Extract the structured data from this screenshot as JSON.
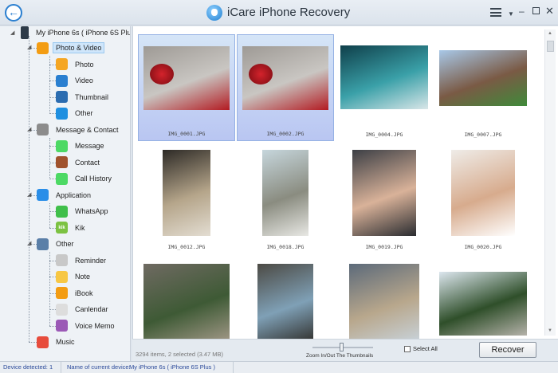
{
  "app": {
    "title": "iCare iPhone Recovery",
    "accent": "#2a7fd0"
  },
  "window": {
    "back_icon": "back-arrow-icon",
    "menu_icon": "hamburger-menu-icon",
    "dropdown_icon": "dropdown-arrow-icon",
    "minimize_glyph": "–",
    "close_glyph": "✕"
  },
  "sidebar": {
    "device": {
      "label": "My iPhone 6s ( iPhone 6S Plus )",
      "icon": "phone-icon"
    },
    "groups": [
      {
        "label": "Photo & Video",
        "icon": "photos-icon",
        "color": "#f39c12",
        "selected": true,
        "items": [
          {
            "label": "Photo",
            "icon": "photo-icon",
            "color": "#f5a623"
          },
          {
            "label": "Video",
            "icon": "video-camera-icon",
            "color": "#2a7fd0"
          },
          {
            "label": "Thumbnail",
            "icon": "thumbnail-icon",
            "color": "#2b6cb0"
          },
          {
            "label": "Other",
            "icon": "picture-icon",
            "color": "#1f8fe0"
          }
        ]
      },
      {
        "label": "Message & Contact",
        "icon": "contacts-icon",
        "color": "#8c8c8c",
        "items": [
          {
            "label": "Message",
            "icon": "message-icon",
            "color": "#4cd964"
          },
          {
            "label": "Contact",
            "icon": "contact-icon",
            "color": "#a0522d"
          },
          {
            "label": "Call History",
            "icon": "phone-call-icon",
            "color": "#4cd964"
          }
        ]
      },
      {
        "label": "Application",
        "icon": "app-store-icon",
        "color": "#2a8ee8",
        "items": [
          {
            "label": "WhatsApp",
            "icon": "whatsapp-icon",
            "color": "#3fbf4a"
          },
          {
            "label": "Kik",
            "icon": "kik-icon",
            "color": "#7cc242",
            "glyph": "kik"
          }
        ]
      },
      {
        "label": "Other",
        "icon": "list-icon",
        "color": "#5a7fa8",
        "items": [
          {
            "label": "Reminder",
            "icon": "reminder-icon",
            "color": "#c8c8c8"
          },
          {
            "label": "Note",
            "icon": "note-icon",
            "color": "#f7c744"
          },
          {
            "label": "iBook",
            "icon": "ibook-icon",
            "color": "#f39c12"
          },
          {
            "label": "Canlendar",
            "icon": "calendar-icon",
            "color": "#dddddd"
          },
          {
            "label": "Voice Memo",
            "icon": "microphone-icon",
            "color": "#9b59b6"
          }
        ]
      },
      {
        "label": "Music",
        "icon": "music-icon",
        "color": "#e74c3c",
        "items": []
      }
    ]
  },
  "thumbnails": [
    {
      "name": "IMG_0001.JPG",
      "selected": true,
      "colors": [
        "#9e9a95",
        "#c9c6c2",
        "#b31b22"
      ]
    },
    {
      "name": "IMG_0002.JPG",
      "selected": true,
      "colors": [
        "#9e9a95",
        "#c9c6c2",
        "#b31b22"
      ]
    },
    {
      "name": "IMG_0004.JPG",
      "selected": false,
      "colors": [
        "#0f3f4a",
        "#3aa0a8",
        "#d9e6e8"
      ]
    },
    {
      "name": "IMG_0007.JPG",
      "selected": false,
      "colors": [
        "#a8c8e8",
        "#7a5a45",
        "#3f8a3a"
      ]
    },
    {
      "name": "IMG_0012.JPG",
      "selected": false,
      "colors": [
        "#2d2a26",
        "#b5a58a",
        "#e3ddd2"
      ]
    },
    {
      "name": "IMG_0018.JPG",
      "selected": false,
      "colors": [
        "#c6d6dc",
        "#8a8c80",
        "#e8e8e4"
      ]
    },
    {
      "name": "IMG_0019.JPG",
      "selected": false,
      "colors": [
        "#3c3f45",
        "#d9b299",
        "#2a2c30"
      ]
    },
    {
      "name": "IMG_0020.JPG",
      "selected": false,
      "colors": [
        "#efece8",
        "#d7ab8d",
        "#ffffff"
      ]
    },
    {
      "name": "",
      "selected": false,
      "colors": [
        "#6f6a62",
        "#3e5a35",
        "#a59a8a"
      ]
    },
    {
      "name": "",
      "selected": false,
      "colors": [
        "#4c4a44",
        "#7fa0b6",
        "#2e2c28"
      ]
    },
    {
      "name": "",
      "selected": false,
      "colors": [
        "#5c6a7a",
        "#b8a78c",
        "#c9d4dd"
      ]
    },
    {
      "name": "",
      "selected": false,
      "colors": [
        "#dce6ee",
        "#2f4f2a",
        "#b5b2aa"
      ]
    }
  ],
  "bottom": {
    "summary": "3294 items, 2 selected (3.47 MB)",
    "zoom_label": "Zoom In/Out The Thumbnails",
    "select_all": "Select All",
    "recover": "Recover"
  },
  "status": {
    "detected_label": "Device detected:",
    "detected_count": "1",
    "current_label": "Name of current device:",
    "current_value": "My iPhone 6s ( iPhone 6S Plus )"
  }
}
